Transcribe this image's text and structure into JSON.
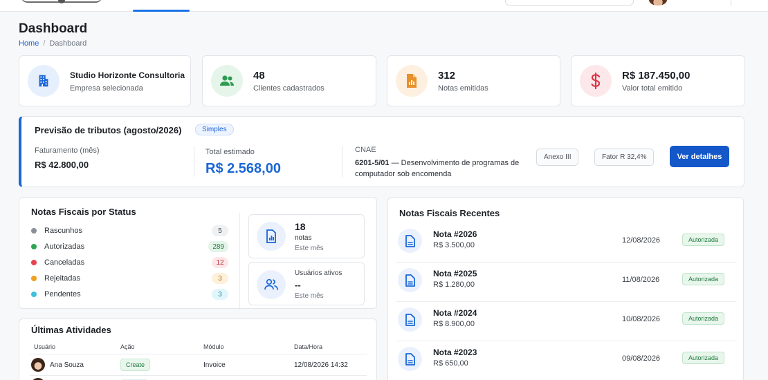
{
  "header": {
    "nav_active": "",
    "icons": {
      "search": "search-field",
      "avatar": "user-avatar"
    }
  },
  "page": {
    "title": "Dashboard",
    "breadcrumb": {
      "home": "Home",
      "separator": "/",
      "current": "Dashboard"
    }
  },
  "stats": [
    {
      "value": "Studio Horizonte Consultoria",
      "label": "Empresa selecionada",
      "icon": "building-icon",
      "color": "#1a66d6",
      "bg": "#e6effc"
    },
    {
      "value": "48",
      "label": "Clientes cadastrados",
      "icon": "users-icon",
      "color": "#2e9b50",
      "bg": "#e6f5ea"
    },
    {
      "value": "312",
      "label": "Notas emitidas",
      "icon": "document-chart-icon",
      "color": "#e8902a",
      "bg": "#fdf0e0"
    },
    {
      "value": "R$  187.450,00",
      "label": "Valor total emitido",
      "icon": "dollar-icon",
      "color": "#dc3545",
      "bg": "#fce8ea"
    }
  ],
  "tax": {
    "title": "Previsão de tributos (agosto/2026)",
    "badge": "Simples",
    "revenue_label": "Faturamento (mês)",
    "revenue_value": "R$ 42.800,00",
    "total_label": "Total estimado",
    "total_value": "R$ 2.568,00",
    "cnae_label": "CNAE",
    "cnae_code": "6201-5/01",
    "cnae_desc": " — Desenvolvimento de programas de computador sob encomenda",
    "annex": "Anexo III",
    "factor": "Fator R 32,4%",
    "details_button": "Ver detalhes",
    "accent": "#1a66d6"
  },
  "status": {
    "title": "Notas Fiscais por Status",
    "items": [
      {
        "label": "Rascunhos",
        "count": "5",
        "dot": "#8a8f98",
        "text": "#4a4f57",
        "bg": "#eef0f2"
      },
      {
        "label": "Autorizadas",
        "count": "289",
        "dot": "#2ea651",
        "text": "#1f7a3d",
        "bg": "#e3f4e8"
      },
      {
        "label": "Canceladas",
        "count": "12",
        "dot": "#e5434f",
        "text": "#c0323d",
        "bg": "#fde6e8"
      },
      {
        "label": "Rejeitadas",
        "count": "3",
        "dot": "#f0a020",
        "text": "#b7770f",
        "bg": "#fdf1dc"
      },
      {
        "label": "Pendentes",
        "count": "3",
        "dot": "#3cc1dc",
        "text": "#1a8aa3",
        "bg": "#e1f6fa"
      }
    ],
    "month_card": {
      "value": "18",
      "unit": "notas",
      "caption": "Este mês"
    },
    "users_card": {
      "title": "Usuários ativos",
      "value": "--",
      "caption": "Este mês"
    }
  },
  "activities": {
    "title": "Últimas Atividades",
    "columns": [
      "Usuário",
      "Ação",
      "Módulo",
      "Data/Hora"
    ],
    "rows": [
      {
        "user": "Ana Souza",
        "action": "Create",
        "module": "Invoice",
        "datetime": "12/08/2026 14:32"
      }
    ]
  },
  "recent": {
    "title": "Notas Fiscais Recentes",
    "notes": [
      {
        "title": "Nota #2026",
        "amount": "R$ 3.500,00",
        "date": "12/08/2026",
        "status": "Autorizada"
      },
      {
        "title": "Nota #2025",
        "amount": "R$ 1.280,00",
        "date": "11/08/2026",
        "status": "Autorizada"
      },
      {
        "title": "Nota #2024",
        "amount": "R$ 8.900,00",
        "date": "10/08/2026",
        "status": "Autorizada"
      },
      {
        "title": "Nota #2023",
        "amount": "R$ 650,00",
        "date": "09/08/2026",
        "status": "Autorizada"
      }
    ]
  }
}
